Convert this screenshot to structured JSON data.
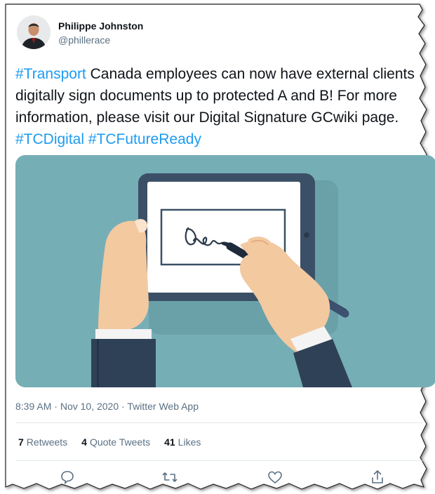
{
  "author": {
    "name": "Philippe Johnston",
    "handle": "@phillerace"
  },
  "tweet": {
    "segments": [
      {
        "text": "#Transport",
        "hashtag": true
      },
      {
        "text": " Canada employees can now have external clients digitally sign documents up to protected A and B! For more information, please visit our Digital Signature GCwiki page. ",
        "hashtag": false
      },
      {
        "text": "#TCDigital",
        "hashtag": true
      },
      {
        "text": " ",
        "hashtag": false
      },
      {
        "text": "#TCFutureReady",
        "hashtag": true
      }
    ]
  },
  "meta": {
    "time": "8:39 AM",
    "date": "Nov 10, 2020",
    "source": "Twitter Web App",
    "separator": "·"
  },
  "stats": {
    "retweets": {
      "count": "7",
      "label": "Retweets"
    },
    "quote_tweets": {
      "count": "4",
      "label": "Quote Tweets"
    },
    "likes": {
      "count": "41",
      "label": "Likes"
    }
  },
  "actions": [
    {
      "name": "reply-icon"
    },
    {
      "name": "retweet-icon"
    },
    {
      "name": "like-icon"
    },
    {
      "name": "share-icon"
    }
  ],
  "colors": {
    "hashtag": "#1d9bf0",
    "media_bg": "#76aeb6",
    "text": "#0f1419",
    "muted": "#5b7083"
  }
}
